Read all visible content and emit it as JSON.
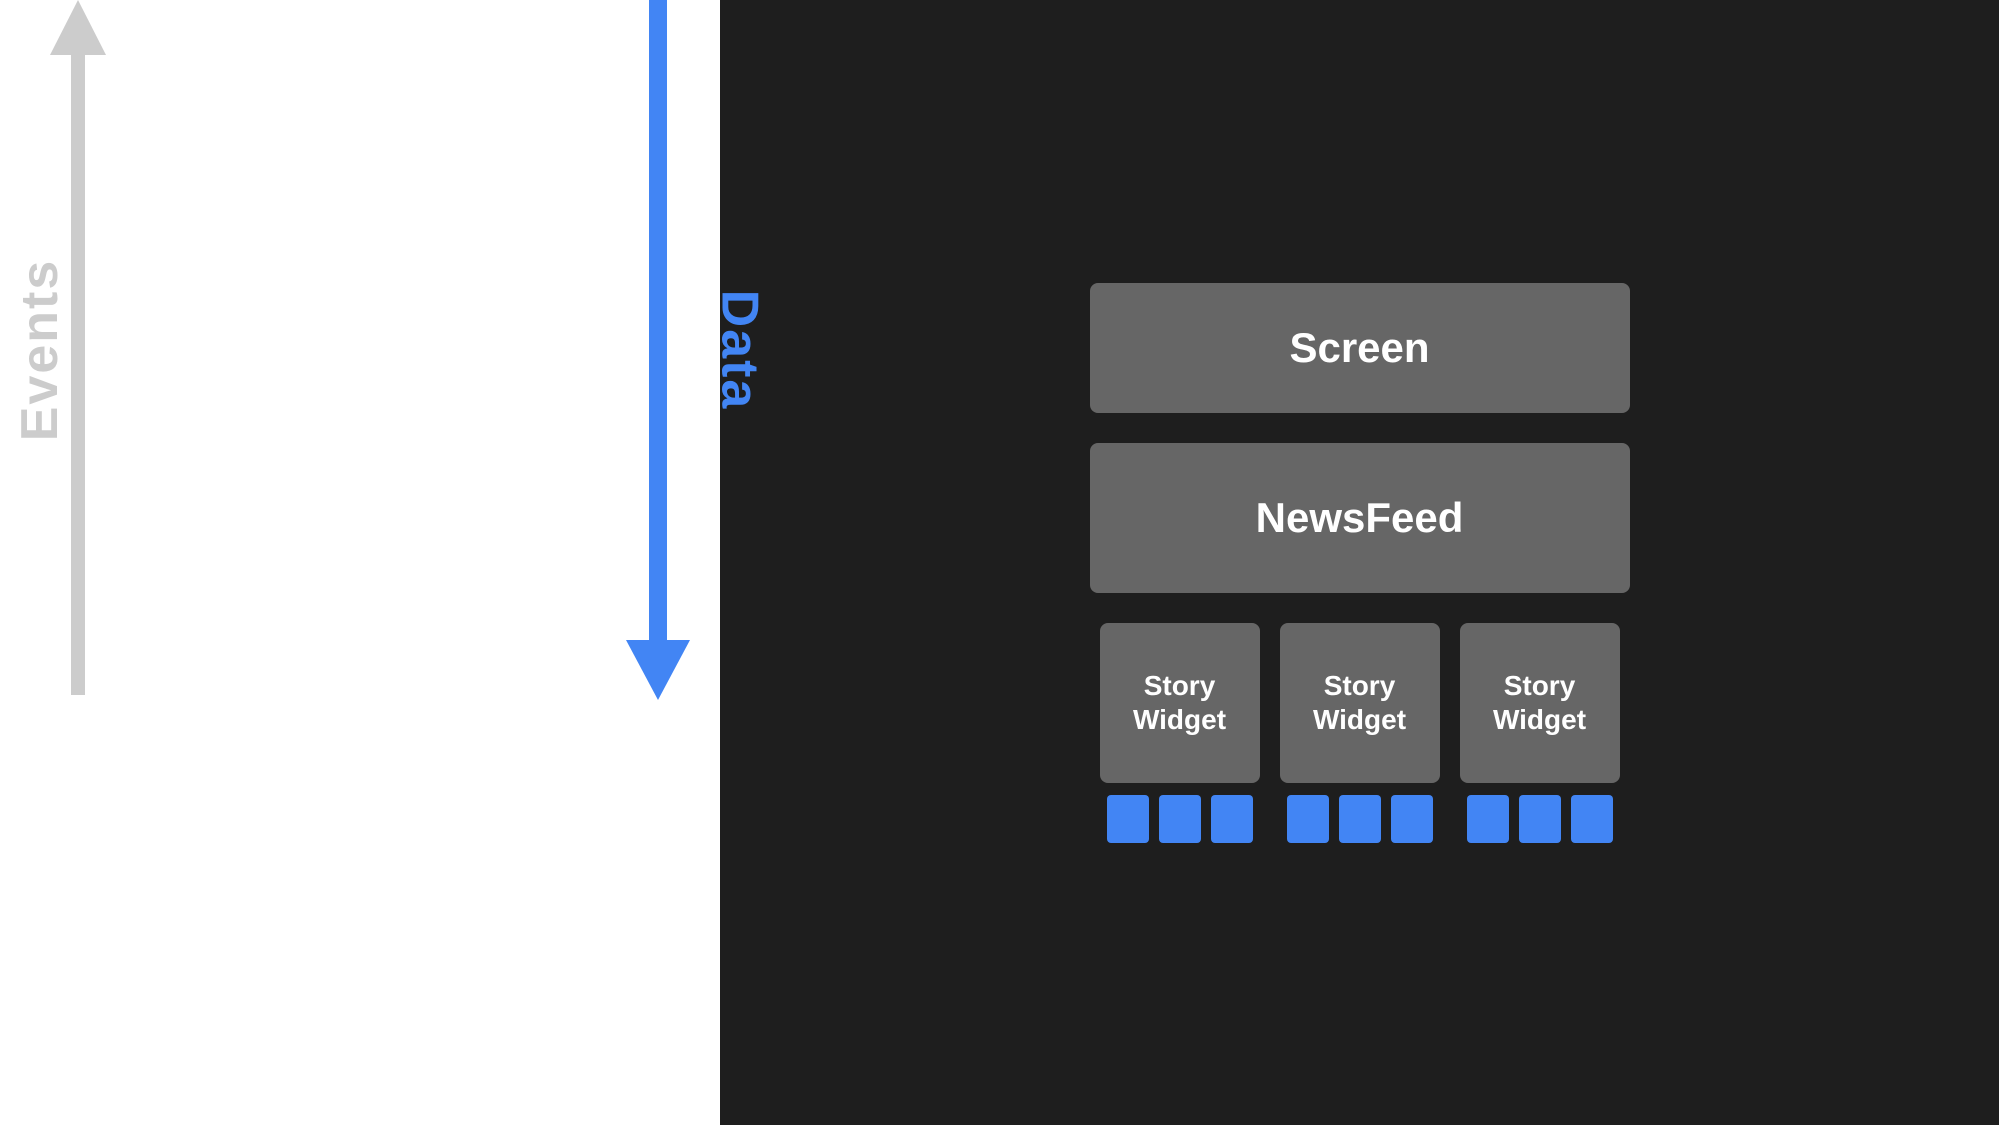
{
  "left": {
    "events_label": "Events",
    "data_label": "Data"
  },
  "right": {
    "screen_label": "Screen",
    "newsfeed_label": "NewsFeed",
    "story_widgets": [
      {
        "label": "Story\nWidget"
      },
      {
        "label": "Story\nWidget"
      },
      {
        "label": "Story\nWidget"
      }
    ],
    "blue_squares_per_group": 3
  },
  "colors": {
    "blue": "#4285f4",
    "gray_text": "#cccccc",
    "block_bg": "#666666",
    "dark_bg": "#1e1e1e",
    "white_bg": "#ffffff"
  }
}
